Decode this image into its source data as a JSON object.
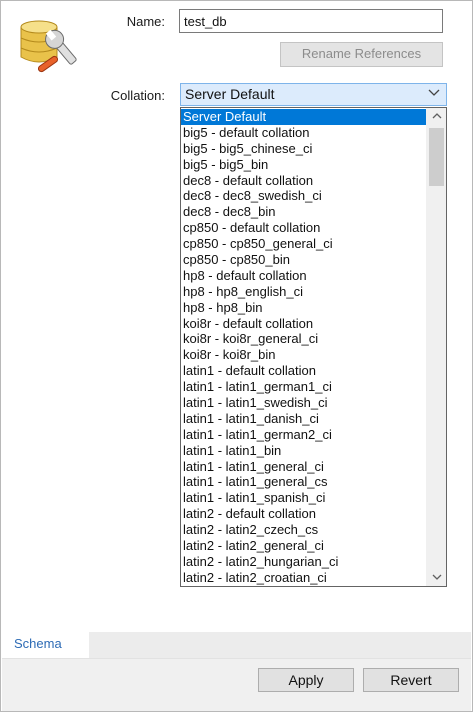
{
  "form": {
    "name_label": "Name:",
    "name_value": "test_db",
    "rename_button": "Rename References",
    "collation_label": "Collation:",
    "collation_selected": "Server Default"
  },
  "collation_options": [
    "Server Default",
    "big5 - default collation",
    "big5 - big5_chinese_ci",
    "big5 - big5_bin",
    "dec8 - default collation",
    "dec8 - dec8_swedish_ci",
    "dec8 - dec8_bin",
    "cp850 - default collation",
    "cp850 - cp850_general_ci",
    "cp850 - cp850_bin",
    "hp8 - default collation",
    "hp8 - hp8_english_ci",
    "hp8 - hp8_bin",
    "koi8r - default collation",
    "koi8r - koi8r_general_ci",
    "koi8r - koi8r_bin",
    "latin1 - default collation",
    "latin1 - latin1_german1_ci",
    "latin1 - latin1_swedish_ci",
    "latin1 - latin1_danish_ci",
    "latin1 - latin1_german2_ci",
    "latin1 - latin1_bin",
    "latin1 - latin1_general_ci",
    "latin1 - latin1_general_cs",
    "latin1 - latin1_spanish_ci",
    "latin2 - default collation",
    "latin2 - latin2_czech_cs",
    "latin2 - latin2_general_ci",
    "latin2 - latin2_hungarian_ci",
    "latin2 - latin2_croatian_ci"
  ],
  "tabs": {
    "schema": "Schema"
  },
  "buttons": {
    "apply": "Apply",
    "revert": "Revert"
  },
  "icons": {
    "schema": "database-wrench-icon",
    "dropdown_arrow": "chevron-down-icon",
    "scroll_up": "chevron-up-icon",
    "scroll_down": "chevron-down-icon"
  },
  "colors": {
    "selection": "#0078d7",
    "combo_focus": "#dcebfc",
    "tab_text": "#2d6bb5"
  }
}
